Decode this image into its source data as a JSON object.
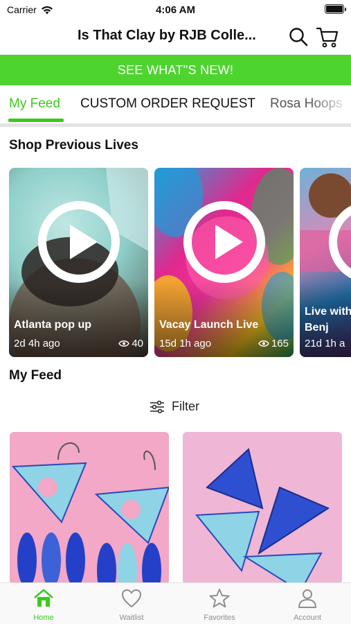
{
  "status_bar": {
    "carrier": "Carrier",
    "time": "4:06 AM"
  },
  "header": {
    "title": "Is That Clay by RJB Colle...",
    "search_icon": "search-icon",
    "cart_icon": "cart-icon"
  },
  "banner": {
    "text": "SEE WHAT\"S NEW!",
    "color": "#4ed42f"
  },
  "tabs": [
    {
      "label": "My Feed",
      "active": true
    },
    {
      "label": "CUSTOM ORDER REQUEST",
      "active": false
    },
    {
      "label": "Rosa Hoops",
      "active": false
    }
  ],
  "accent_color": "#3cc81e",
  "lives_section": {
    "title": "Shop Previous Lives",
    "items": [
      {
        "title": "Atlanta pop up",
        "age": "2d 4h ago",
        "views": "40"
      },
      {
        "title": "Vacay Launch Live",
        "age": "15d 1h ago",
        "views": "165"
      },
      {
        "title": "Live with the Benj",
        "age": "21d 1h a"
      }
    ]
  },
  "feed_section": {
    "title": "My Feed",
    "filter_label": "Filter"
  },
  "bottom_nav": [
    {
      "label": "Home",
      "icon": "home-icon",
      "active": true
    },
    {
      "label": "Waitlist",
      "icon": "heart-icon",
      "active": false
    },
    {
      "label": "Favorites",
      "icon": "star-icon",
      "active": false
    },
    {
      "label": "Account",
      "icon": "account-icon",
      "active": false
    }
  ]
}
